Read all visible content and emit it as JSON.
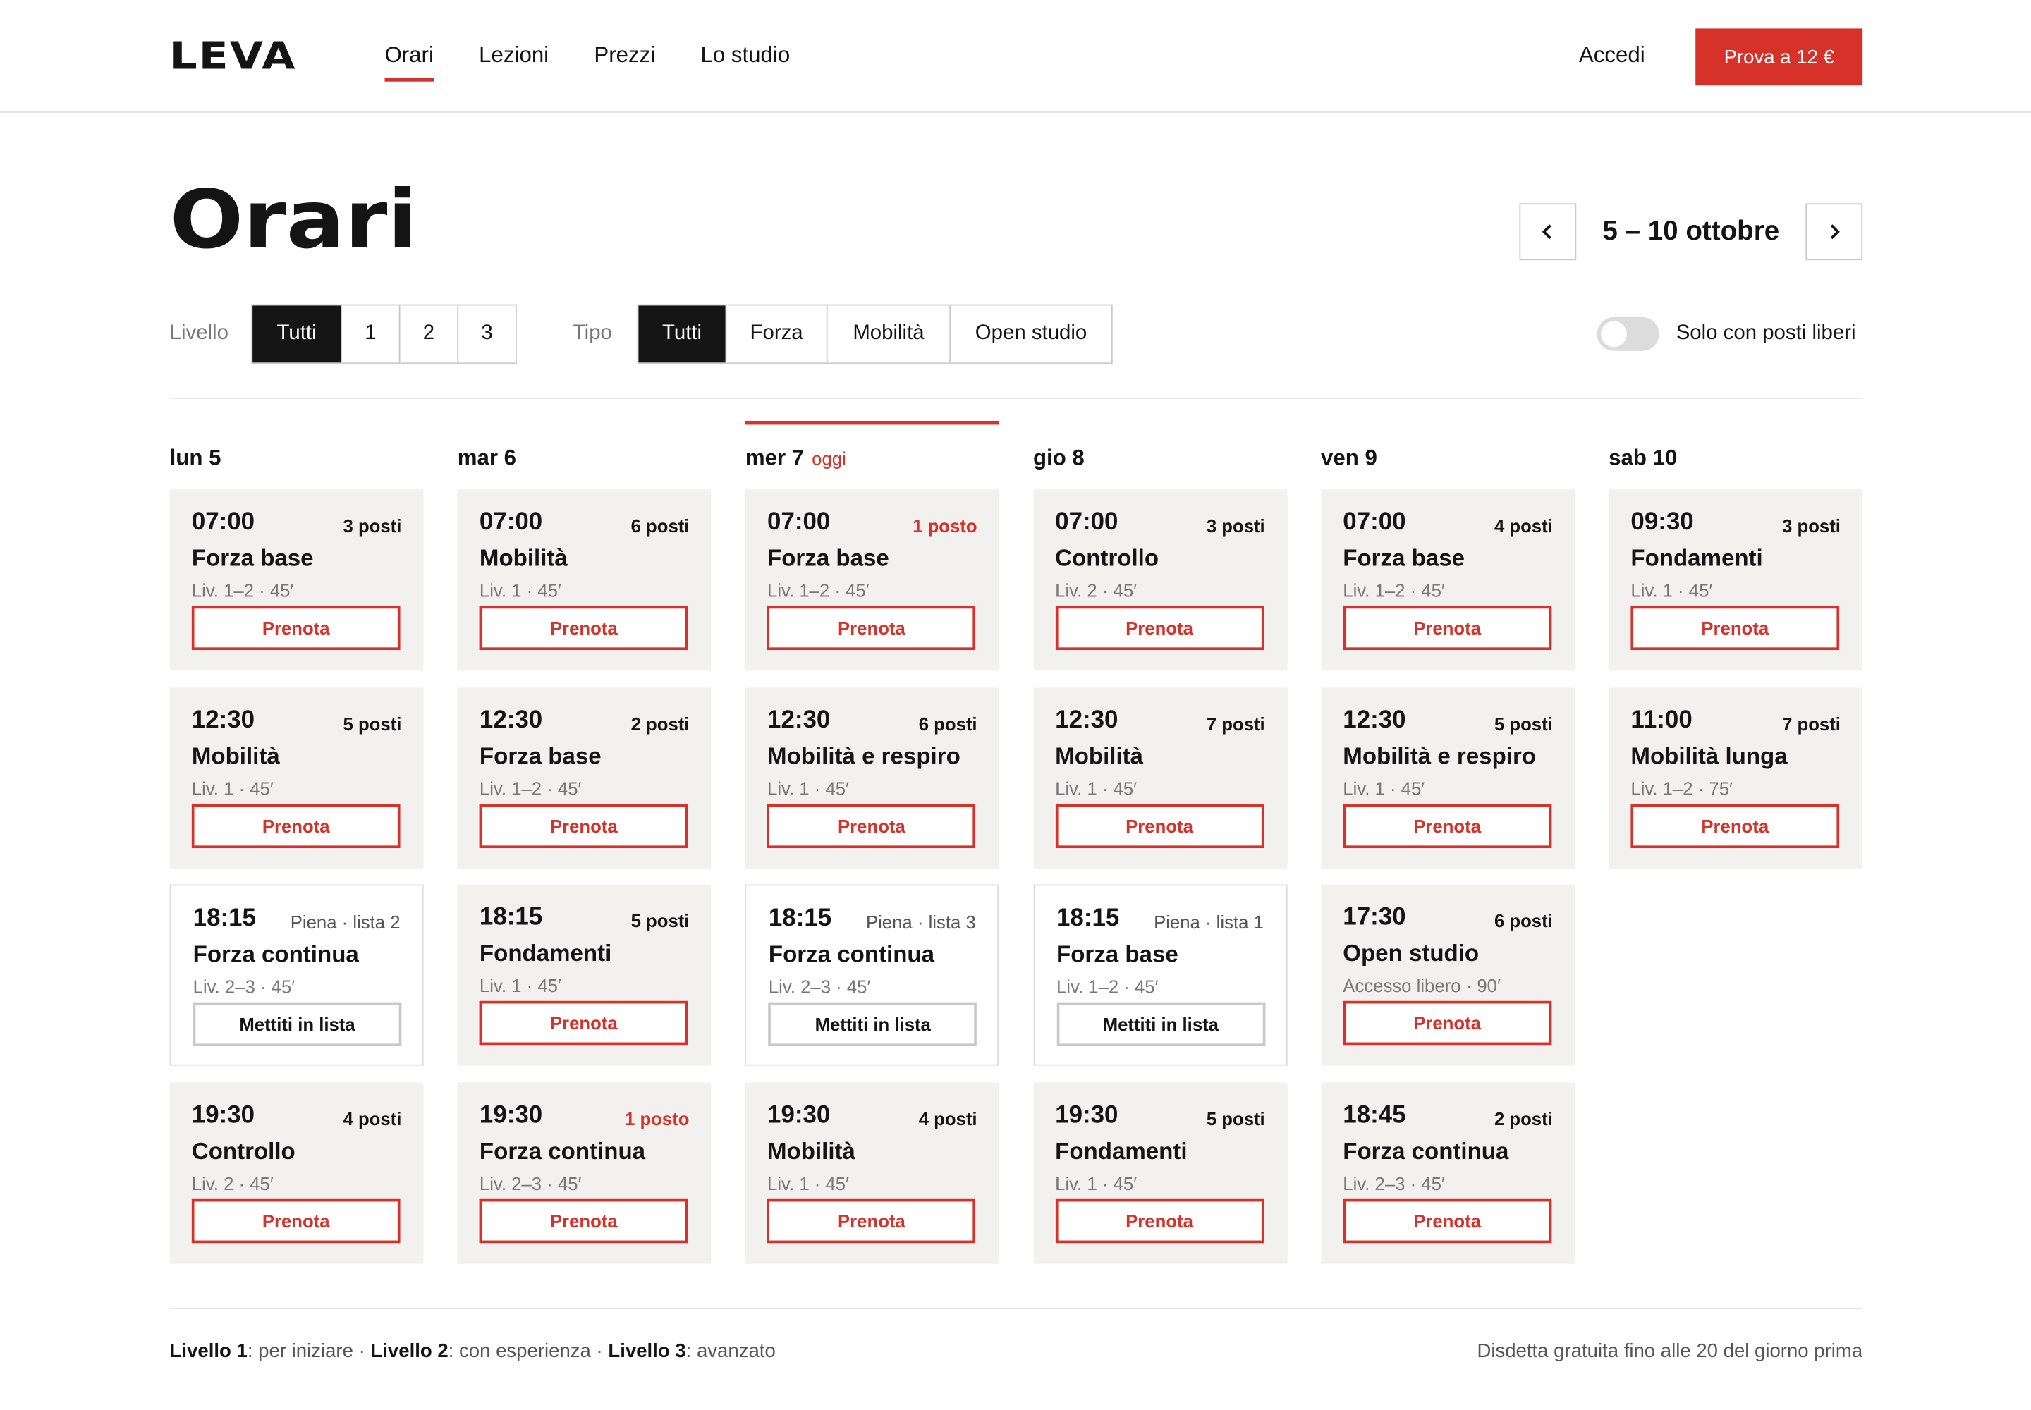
{
  "brand": {
    "logo": "LEVA",
    "accent": "#d6322a"
  },
  "nav": {
    "items": [
      "Orari",
      "Lezioni",
      "Prezzi",
      "Lo studio"
    ],
    "active": "Orari",
    "login": "Accedi",
    "cta": "Prova a 12 €"
  },
  "page": {
    "title": "Orari",
    "week_label": "5 – 10 ottobre",
    "prev_icon": "chevron-left-icon",
    "next_icon": "chevron-right-icon"
  },
  "filters": {
    "level_label": "Livello",
    "level_options": [
      "Tutti",
      "1",
      "2",
      "3"
    ],
    "level_selected": "Tutti",
    "type_label": "Tipo",
    "type_options": [
      "Tutti",
      "Forza",
      "Mobilità",
      "Open studio"
    ],
    "type_selected": "Tutti",
    "only_free_label": "Solo con posti liberi",
    "only_free_on": false
  },
  "today_label": "oggi",
  "days": [
    {
      "label": "lun 5",
      "today": false,
      "classes": [
        {
          "time": "07:00",
          "seats": "3 posti",
          "status": "open",
          "name": "Forza base",
          "meta": "Liv. 1–2 · 45′",
          "action": "Prenota"
        },
        {
          "time": "12:30",
          "seats": "5 posti",
          "status": "open",
          "name": "Mobilità",
          "meta": "Liv. 1 · 45′",
          "action": "Prenota"
        },
        {
          "time": "18:15",
          "seats": "Piena · lista 2",
          "status": "full",
          "name": "Forza continua",
          "meta": "Liv. 2–3 · 45′",
          "action": "Mettiti in lista"
        },
        {
          "time": "19:30",
          "seats": "4 posti",
          "status": "open",
          "name": "Controllo",
          "meta": "Liv. 2 · 45′",
          "action": "Prenota"
        }
      ]
    },
    {
      "label": "mar 6",
      "today": false,
      "classes": [
        {
          "time": "07:00",
          "seats": "6 posti",
          "status": "open",
          "name": "Mobilità",
          "meta": "Liv. 1 · 45′",
          "action": "Prenota"
        },
        {
          "time": "12:30",
          "seats": "2 posti",
          "status": "open",
          "name": "Forza base",
          "meta": "Liv. 1–2 · 45′",
          "action": "Prenota"
        },
        {
          "time": "18:15",
          "seats": "5 posti",
          "status": "open",
          "name": "Fondamenti",
          "meta": "Liv. 1 · 45′",
          "action": "Prenota"
        },
        {
          "time": "19:30",
          "seats": "1 posto",
          "status": "low",
          "name": "Forza continua",
          "meta": "Liv. 2–3 · 45′",
          "action": "Prenota"
        }
      ]
    },
    {
      "label": "mer 7",
      "today": true,
      "classes": [
        {
          "time": "07:00",
          "seats": "1 posto",
          "status": "low",
          "name": "Forza base",
          "meta": "Liv. 1–2 · 45′",
          "action": "Prenota"
        },
        {
          "time": "12:30",
          "seats": "6 posti",
          "status": "open",
          "name": "Mobilità e respiro",
          "meta": "Liv. 1 · 45′",
          "action": "Prenota"
        },
        {
          "time": "18:15",
          "seats": "Piena · lista 3",
          "status": "full",
          "name": "Forza continua",
          "meta": "Liv. 2–3 · 45′",
          "action": "Mettiti in lista"
        },
        {
          "time": "19:30",
          "seats": "4 posti",
          "status": "open",
          "name": "Mobilità",
          "meta": "Liv. 1 · 45′",
          "action": "Prenota"
        }
      ]
    },
    {
      "label": "gio 8",
      "today": false,
      "classes": [
        {
          "time": "07:00",
          "seats": "3 posti",
          "status": "open",
          "name": "Controllo",
          "meta": "Liv. 2 · 45′",
          "action": "Prenota"
        },
        {
          "time": "12:30",
          "seats": "7 posti",
          "status": "open",
          "name": "Mobilità",
          "meta": "Liv. 1 · 45′",
          "action": "Prenota"
        },
        {
          "time": "18:15",
          "seats": "Piena · lista 1",
          "status": "full",
          "name": "Forza base",
          "meta": "Liv. 1–2 · 45′",
          "action": "Mettiti in lista"
        },
        {
          "time": "19:30",
          "seats": "5 posti",
          "status": "open",
          "name": "Fondamenti",
          "meta": "Liv. 1 · 45′",
          "action": "Prenota"
        }
      ]
    },
    {
      "label": "ven 9",
      "today": false,
      "classes": [
        {
          "time": "07:00",
          "seats": "4 posti",
          "status": "open",
          "name": "Forza base",
          "meta": "Liv. 1–2 · 45′",
          "action": "Prenota"
        },
        {
          "time": "12:30",
          "seats": "5 posti",
          "status": "open",
          "name": "Mobilità e respiro",
          "meta": "Liv. 1 · 45′",
          "action": "Prenota"
        },
        {
          "time": "17:30",
          "seats": "6 posti",
          "status": "open",
          "name": "Open studio",
          "meta": "Accesso libero · 90′",
          "action": "Prenota"
        },
        {
          "time": "18:45",
          "seats": "2 posti",
          "status": "open",
          "name": "Forza continua",
          "meta": "Liv. 2–3 · 45′",
          "action": "Prenota"
        }
      ]
    },
    {
      "label": "sab 10",
      "today": false,
      "classes": [
        {
          "time": "09:30",
          "seats": "3 posti",
          "status": "open",
          "name": "Fondamenti",
          "meta": "Liv. 1 · 45′",
          "action": "Prenota"
        },
        {
          "time": "11:00",
          "seats": "7 posti",
          "status": "open",
          "name": "Mobilità lunga",
          "meta": "Liv. 1–2 · 75′",
          "action": "Prenota"
        }
      ]
    }
  ],
  "footer": {
    "legend": [
      {
        "level": "Livello 1",
        "desc": ": per iniziare"
      },
      {
        "level": "Livello 2",
        "desc": ": con esperienza"
      },
      {
        "level": "Livello 3",
        "desc": ": avanzato"
      }
    ],
    "separator": " · ",
    "policy": "Disdetta gratuita fino alle 20 del giorno prima"
  }
}
